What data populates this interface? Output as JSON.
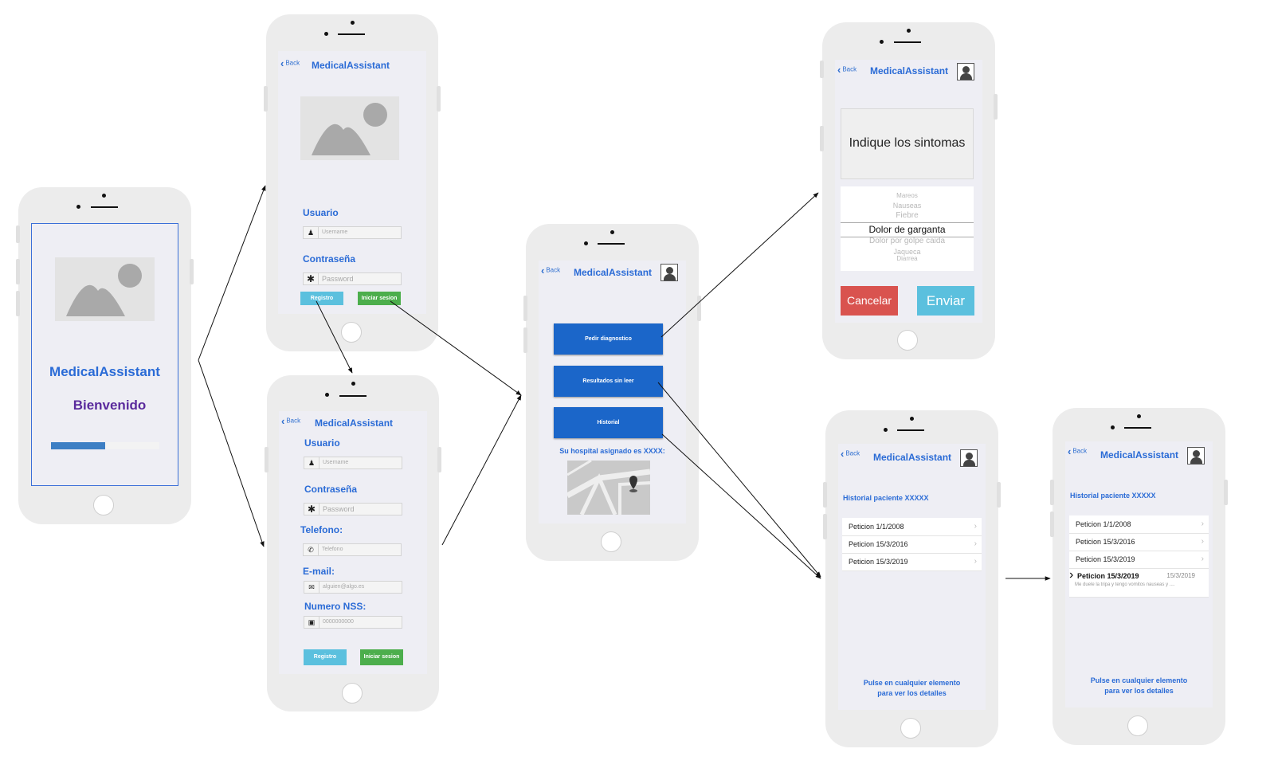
{
  "app_title": "MedicalAssistant",
  "back_label": "Back",
  "splash": {
    "welcome": "Bienvenido",
    "progress": 0.5
  },
  "login": {
    "user_label": "Usuario",
    "user_placeholder": "Username",
    "password_label": "Contraseña",
    "password_placeholder": "Password",
    "register_button": "Registro",
    "login_button": "Iniciar sesion"
  },
  "register": {
    "user_label": "Usuario",
    "user_placeholder": "Username",
    "password_label": "Contraseña",
    "password_placeholder": "Password",
    "phone_label": "Telefono:",
    "phone_placeholder": "Telefono",
    "email_label": "E-mail:",
    "email_placeholder": "alguien@algo.es",
    "nss_label": "Numero NSS:",
    "nss_placeholder": "0000000000",
    "register_button": "Registro",
    "login_button": "Iniciar sesion"
  },
  "menu": {
    "buttons": [
      "Pedir diagnostico",
      "Resultados sin leer",
      "Historial"
    ],
    "hospital_text": "Su hospital asignado es XXXX:"
  },
  "symptoms": {
    "heading": "Indique los sintomas",
    "options": [
      "Mareos",
      "Nauseas",
      "Fiebre",
      "Dolor de garganta",
      "Dolor por golpe caida",
      "Jaqueca",
      "Diarrea"
    ],
    "selected": "Dolor de garganta",
    "cancel_button": "Cancelar",
    "send_button": "Enviar"
  },
  "history": {
    "title": "Historial paciente XXXXX",
    "items": [
      "Peticion 1/1/2008",
      "Peticion 15/3/2016",
      "Peticion 15/3/2019"
    ],
    "footer_line1": "Pulse en cualquier elemento",
    "footer_line2": "para ver los detalles"
  },
  "history_detail": {
    "title": "Historial paciente XXXXX",
    "items": [
      "Peticion 1/1/2008",
      "Peticion 15/3/2016",
      "Peticion 15/3/2019"
    ],
    "expanded_title": "Peticion 15/3/2019",
    "expanded_date": "15/3/2019",
    "expanded_text": "Me duele la tripa y tengo vomitos nauseas y ....",
    "footer_line1": "Pulse en cualquier elemento",
    "footer_line2": "para ver los detalles"
  },
  "colors": {
    "title_blue": "#2a6bd6",
    "welcome_purple": "#5a2a9c",
    "primary_button": "#1b66c9",
    "cancel_red": "#d9534f",
    "send_cyan": "#5bc0de",
    "success_green": "#4cae4c"
  }
}
